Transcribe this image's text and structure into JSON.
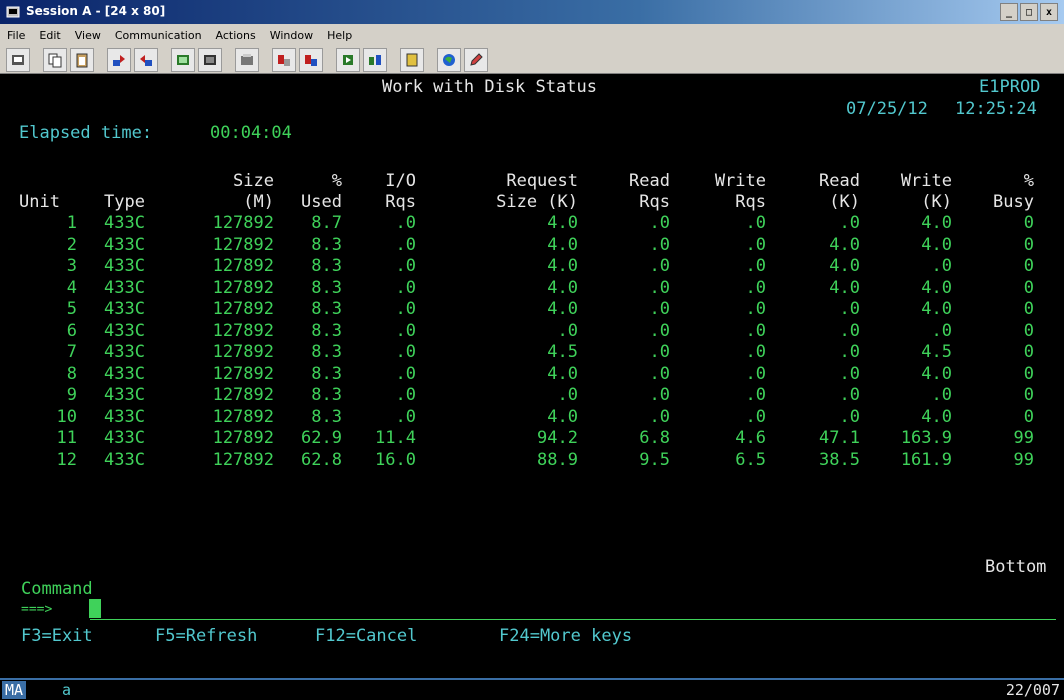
{
  "window": {
    "title": "Session A - [24 x 80]",
    "controls": [
      "_",
      "□",
      "x"
    ]
  },
  "menu": [
    "File",
    "Edit",
    "View",
    "Communication",
    "Actions",
    "Window",
    "Help"
  ],
  "toolbar": [
    "print-screen-icon",
    "copy-icon",
    "paste-icon",
    "send-icon",
    "receive-icon",
    "display-keypad-icon",
    "color-map-icon",
    "macro-icon",
    "record-macro-icon",
    "stop-macro-icon",
    "play-macro-icon",
    "ftp-icon",
    "help-icon",
    "globe-icon",
    "edit-icon"
  ],
  "screen": {
    "title": "Work with Disk Status",
    "system": "E1PROD",
    "date": "07/25/12",
    "time": "12:25:24",
    "elapsed_label": "Elapsed time:",
    "elapsed_value": "00:04:04",
    "headers_row1": [
      "",
      "",
      "Size",
      "%",
      "I/O",
      "Request",
      "Read",
      "Write",
      "Read",
      "Write",
      "%"
    ],
    "headers_row2": [
      "Unit",
      "Type",
      "(M)",
      "Used",
      "Rqs",
      "Size (K)",
      "Rqs",
      "Rqs",
      "(K)",
      "(K)",
      "Busy"
    ],
    "rows": [
      [
        "1",
        "433C",
        "127892",
        "8.7",
        ".0",
        "4.0",
        ".0",
        ".0",
        ".0",
        "4.0",
        "0"
      ],
      [
        "2",
        "433C",
        "127892",
        "8.3",
        ".0",
        "4.0",
        ".0",
        ".0",
        "4.0",
        "4.0",
        "0"
      ],
      [
        "3",
        "433C",
        "127892",
        "8.3",
        ".0",
        "4.0",
        ".0",
        ".0",
        "4.0",
        ".0",
        "0"
      ],
      [
        "4",
        "433C",
        "127892",
        "8.3",
        ".0",
        "4.0",
        ".0",
        ".0",
        "4.0",
        "4.0",
        "0"
      ],
      [
        "5",
        "433C",
        "127892",
        "8.3",
        ".0",
        "4.0",
        ".0",
        ".0",
        ".0",
        "4.0",
        "0"
      ],
      [
        "6",
        "433C",
        "127892",
        "8.3",
        ".0",
        ".0",
        ".0",
        ".0",
        ".0",
        ".0",
        "0"
      ],
      [
        "7",
        "433C",
        "127892",
        "8.3",
        ".0",
        "4.5",
        ".0",
        ".0",
        ".0",
        "4.5",
        "0"
      ],
      [
        "8",
        "433C",
        "127892",
        "8.3",
        ".0",
        "4.0",
        ".0",
        ".0",
        ".0",
        "4.0",
        "0"
      ],
      [
        "9",
        "433C",
        "127892",
        "8.3",
        ".0",
        ".0",
        ".0",
        ".0",
        ".0",
        ".0",
        "0"
      ],
      [
        "10",
        "433C",
        "127892",
        "8.3",
        ".0",
        "4.0",
        ".0",
        ".0",
        ".0",
        "4.0",
        "0"
      ],
      [
        "11",
        "433C",
        "127892",
        "62.9",
        "11.4",
        "94.2",
        "6.8",
        "4.6",
        "47.1",
        "163.9",
        "99"
      ],
      [
        "12",
        "433C",
        "127892",
        "62.8",
        "16.0",
        "88.9",
        "9.5",
        "6.5",
        "38.5",
        "161.9",
        "99"
      ]
    ],
    "bottom_label": "Bottom",
    "command_label": "Command",
    "prompt": "===>",
    "fkeys": [
      "F3=Exit",
      "F5=Refresh",
      "F12=Cancel",
      "F24=More keys"
    ]
  },
  "status": {
    "indicator": "MA",
    "mode": "a",
    "position": "22/007"
  },
  "colors": {
    "terminal_bg": "#000000",
    "green": "#3fd25a",
    "white": "#e6e6e6",
    "cyan": "#52c8ce",
    "titlebar": "#0a246a"
  }
}
